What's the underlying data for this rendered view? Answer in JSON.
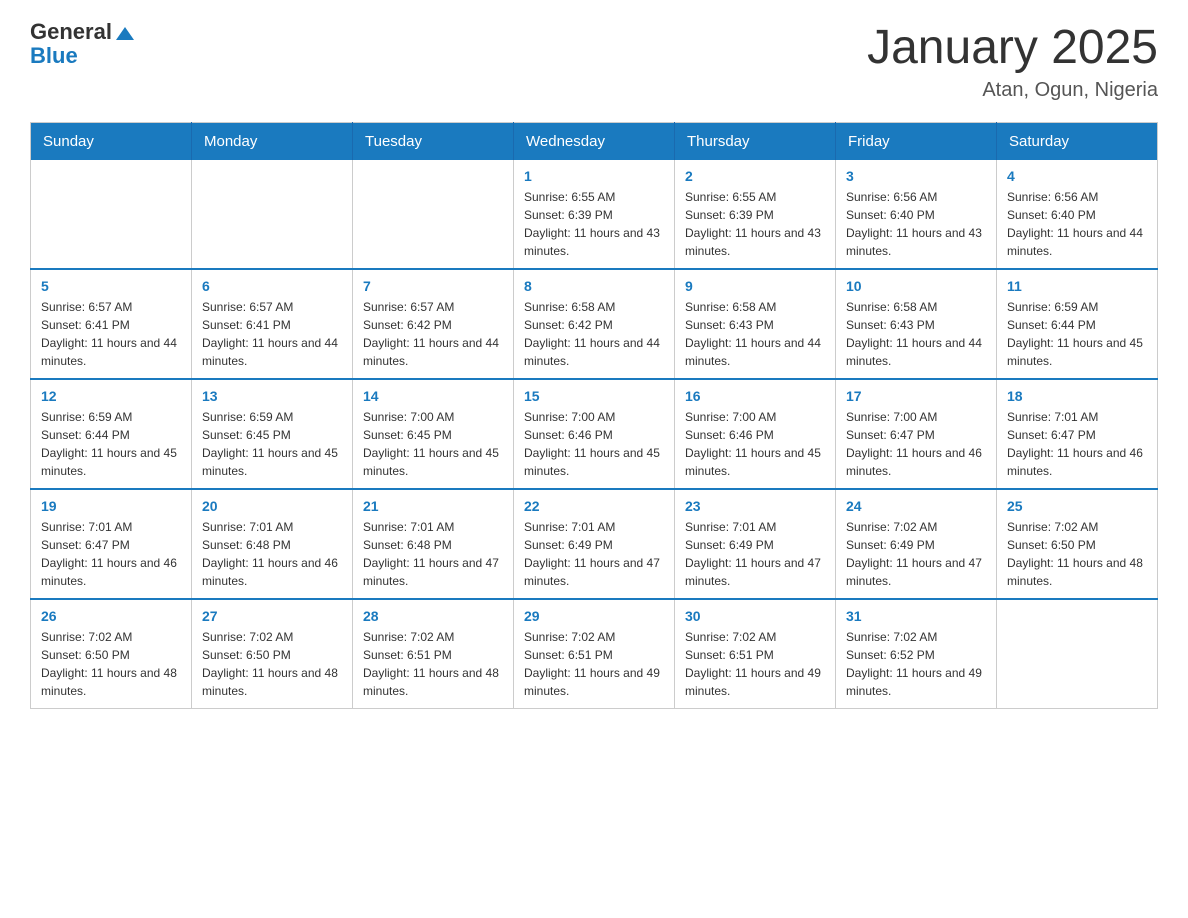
{
  "header": {
    "logo_text_general": "General",
    "logo_text_blue": "Blue",
    "month_title": "January 2025",
    "location": "Atan, Ogun, Nigeria"
  },
  "days_of_week": [
    "Sunday",
    "Monday",
    "Tuesday",
    "Wednesday",
    "Thursday",
    "Friday",
    "Saturday"
  ],
  "weeks": [
    {
      "days": [
        {
          "number": "",
          "info": ""
        },
        {
          "number": "",
          "info": ""
        },
        {
          "number": "",
          "info": ""
        },
        {
          "number": "1",
          "info": "Sunrise: 6:55 AM\nSunset: 6:39 PM\nDaylight: 11 hours and 43 minutes."
        },
        {
          "number": "2",
          "info": "Sunrise: 6:55 AM\nSunset: 6:39 PM\nDaylight: 11 hours and 43 minutes."
        },
        {
          "number": "3",
          "info": "Sunrise: 6:56 AM\nSunset: 6:40 PM\nDaylight: 11 hours and 43 minutes."
        },
        {
          "number": "4",
          "info": "Sunrise: 6:56 AM\nSunset: 6:40 PM\nDaylight: 11 hours and 44 minutes."
        }
      ]
    },
    {
      "days": [
        {
          "number": "5",
          "info": "Sunrise: 6:57 AM\nSunset: 6:41 PM\nDaylight: 11 hours and 44 minutes."
        },
        {
          "number": "6",
          "info": "Sunrise: 6:57 AM\nSunset: 6:41 PM\nDaylight: 11 hours and 44 minutes."
        },
        {
          "number": "7",
          "info": "Sunrise: 6:57 AM\nSunset: 6:42 PM\nDaylight: 11 hours and 44 minutes."
        },
        {
          "number": "8",
          "info": "Sunrise: 6:58 AM\nSunset: 6:42 PM\nDaylight: 11 hours and 44 minutes."
        },
        {
          "number": "9",
          "info": "Sunrise: 6:58 AM\nSunset: 6:43 PM\nDaylight: 11 hours and 44 minutes."
        },
        {
          "number": "10",
          "info": "Sunrise: 6:58 AM\nSunset: 6:43 PM\nDaylight: 11 hours and 44 minutes."
        },
        {
          "number": "11",
          "info": "Sunrise: 6:59 AM\nSunset: 6:44 PM\nDaylight: 11 hours and 45 minutes."
        }
      ]
    },
    {
      "days": [
        {
          "number": "12",
          "info": "Sunrise: 6:59 AM\nSunset: 6:44 PM\nDaylight: 11 hours and 45 minutes."
        },
        {
          "number": "13",
          "info": "Sunrise: 6:59 AM\nSunset: 6:45 PM\nDaylight: 11 hours and 45 minutes."
        },
        {
          "number": "14",
          "info": "Sunrise: 7:00 AM\nSunset: 6:45 PM\nDaylight: 11 hours and 45 minutes."
        },
        {
          "number": "15",
          "info": "Sunrise: 7:00 AM\nSunset: 6:46 PM\nDaylight: 11 hours and 45 minutes."
        },
        {
          "number": "16",
          "info": "Sunrise: 7:00 AM\nSunset: 6:46 PM\nDaylight: 11 hours and 45 minutes."
        },
        {
          "number": "17",
          "info": "Sunrise: 7:00 AM\nSunset: 6:47 PM\nDaylight: 11 hours and 46 minutes."
        },
        {
          "number": "18",
          "info": "Sunrise: 7:01 AM\nSunset: 6:47 PM\nDaylight: 11 hours and 46 minutes."
        }
      ]
    },
    {
      "days": [
        {
          "number": "19",
          "info": "Sunrise: 7:01 AM\nSunset: 6:47 PM\nDaylight: 11 hours and 46 minutes."
        },
        {
          "number": "20",
          "info": "Sunrise: 7:01 AM\nSunset: 6:48 PM\nDaylight: 11 hours and 46 minutes."
        },
        {
          "number": "21",
          "info": "Sunrise: 7:01 AM\nSunset: 6:48 PM\nDaylight: 11 hours and 47 minutes."
        },
        {
          "number": "22",
          "info": "Sunrise: 7:01 AM\nSunset: 6:49 PM\nDaylight: 11 hours and 47 minutes."
        },
        {
          "number": "23",
          "info": "Sunrise: 7:01 AM\nSunset: 6:49 PM\nDaylight: 11 hours and 47 minutes."
        },
        {
          "number": "24",
          "info": "Sunrise: 7:02 AM\nSunset: 6:49 PM\nDaylight: 11 hours and 47 minutes."
        },
        {
          "number": "25",
          "info": "Sunrise: 7:02 AM\nSunset: 6:50 PM\nDaylight: 11 hours and 48 minutes."
        }
      ]
    },
    {
      "days": [
        {
          "number": "26",
          "info": "Sunrise: 7:02 AM\nSunset: 6:50 PM\nDaylight: 11 hours and 48 minutes."
        },
        {
          "number": "27",
          "info": "Sunrise: 7:02 AM\nSunset: 6:50 PM\nDaylight: 11 hours and 48 minutes."
        },
        {
          "number": "28",
          "info": "Sunrise: 7:02 AM\nSunset: 6:51 PM\nDaylight: 11 hours and 48 minutes."
        },
        {
          "number": "29",
          "info": "Sunrise: 7:02 AM\nSunset: 6:51 PM\nDaylight: 11 hours and 49 minutes."
        },
        {
          "number": "30",
          "info": "Sunrise: 7:02 AM\nSunset: 6:51 PM\nDaylight: 11 hours and 49 minutes."
        },
        {
          "number": "31",
          "info": "Sunrise: 7:02 AM\nSunset: 6:52 PM\nDaylight: 11 hours and 49 minutes."
        },
        {
          "number": "",
          "info": ""
        }
      ]
    }
  ]
}
